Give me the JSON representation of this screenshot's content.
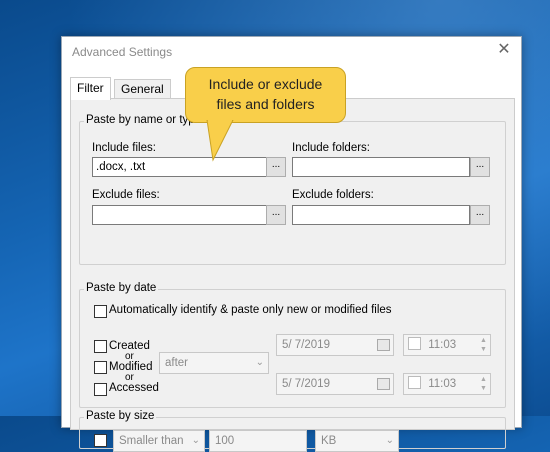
{
  "window": {
    "title": "Advanced Settings",
    "close_glyph": "✕"
  },
  "tabs": [
    {
      "label": "Filter",
      "active": true
    },
    {
      "label": "General",
      "active": false
    }
  ],
  "callout": {
    "line1": "Include or exclude",
    "line2": "files and folders"
  },
  "paste_by_name": {
    "label": "Paste by name or type",
    "include_files": {
      "label": "Include files:",
      "value": ".docx, .txt"
    },
    "include_folders": {
      "label": "Include folders:",
      "value": ""
    },
    "exclude_files": {
      "label": "Exclude files:",
      "value": ""
    },
    "exclude_folders": {
      "label": "Exclude folders:",
      "value": ""
    },
    "browse_label": "..."
  },
  "paste_by_date": {
    "label": "Paste by date",
    "auto_label": "Automatically identify & paste only new or modified files",
    "created_label": "Created",
    "or1": "or",
    "modified_label": "Modified",
    "or2": "or",
    "accessed_label": "Accessed",
    "condition": "after",
    "date1": "5/  7/2019",
    "time1": "11:03",
    "date2": "5/  7/2019",
    "time2": "11:03"
  },
  "paste_by_size": {
    "label": "Paste by size",
    "comparison": "Smaller than",
    "amount": "100",
    "unit": "KB"
  }
}
